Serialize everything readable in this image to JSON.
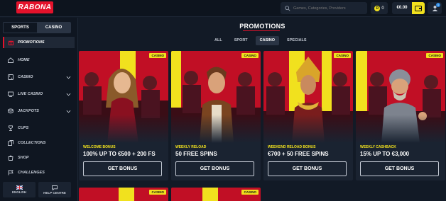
{
  "header": {
    "logo": "RABONA",
    "search_placeholder": "Games, Categories, Providers",
    "coins_value": "0",
    "balance": "€0.00",
    "notification_count": "1"
  },
  "sidebar": {
    "segments": [
      {
        "label": "SPORTS",
        "active": false
      },
      {
        "label": "CASINO",
        "active": true
      }
    ],
    "promotions_label": "PROMOTIONS",
    "items": [
      {
        "label": "HOME",
        "icon": "home-icon",
        "chevron": false
      },
      {
        "label": "CASINO",
        "icon": "casino-icon",
        "chevron": true
      },
      {
        "label": "LIVE CASINO",
        "icon": "live-casino-icon",
        "chevron": true
      },
      {
        "label": "JACKPOTS",
        "icon": "jackpots-icon",
        "chevron": true
      },
      {
        "label": "CUPS",
        "icon": "cup-icon",
        "chevron": false
      },
      {
        "label": "COLLECTIONS",
        "icon": "collections-icon",
        "chevron": false
      },
      {
        "label": "SHOP",
        "icon": "shop-icon",
        "chevron": false
      },
      {
        "label": "CHALLENGES",
        "icon": "challenges-icon",
        "chevron": false
      }
    ],
    "footer": {
      "language": "ENGLISH",
      "help": "HELP CENTRE"
    }
  },
  "main": {
    "title": "PROMOTIONS",
    "tabs": [
      {
        "label": "ALL",
        "active": false
      },
      {
        "label": "SPORT",
        "active": false
      },
      {
        "label": "CASINO",
        "active": true
      },
      {
        "label": "SPECIALS",
        "active": false
      }
    ],
    "cards": [
      {
        "tag": "CASINO",
        "category": "WELCOME BONUS",
        "offer": "100% UP TO €500 + 200 FS",
        "button": "GET BONUS"
      },
      {
        "tag": "CASINO",
        "category": "WEEKLY RELOAD",
        "offer": "50 FREE SPINS",
        "button": "GET BONUS"
      },
      {
        "tag": "CASINO",
        "category": "WEEKEND RELOAD BONUS",
        "offer": "€700 + 50 FREE SPINS",
        "button": "GET BONUS"
      },
      {
        "tag": "CASINO",
        "category": "WEEKLY CASHBACK",
        "offer": "15% UP TO €3,000",
        "button": "GET BONUS"
      }
    ],
    "next_row_tags": [
      "CASINO",
      "CASINO"
    ]
  },
  "colors": {
    "brand_red": "#e4122b",
    "accent_yellow": "#f1e11e",
    "background": "#121a26",
    "card": "#1a2331"
  }
}
